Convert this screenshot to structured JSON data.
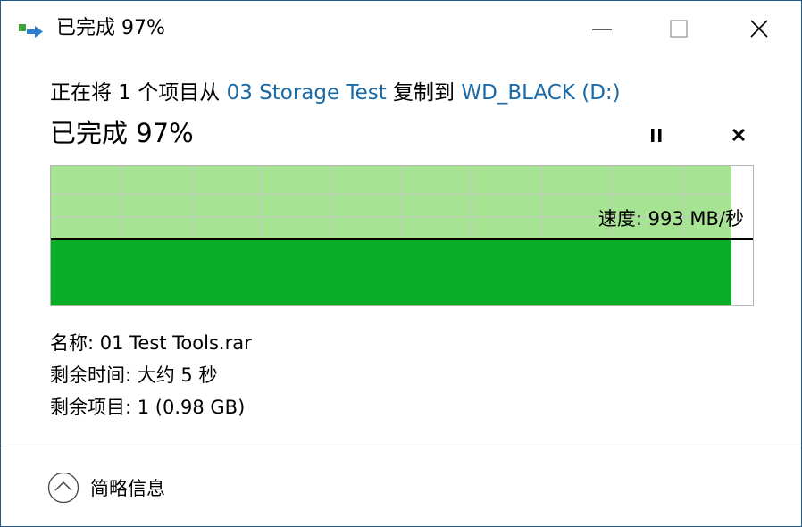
{
  "window": {
    "title": "已完成 97%",
    "icon": "copy-arrow-icon"
  },
  "operation": {
    "prefix": "正在将 1 个项目从 ",
    "source": "03 Storage Test",
    "middle": " 复制到 ",
    "destination": "WD_BLACK (D:)"
  },
  "status": {
    "title": "已完成 97%",
    "progress_percent": 97
  },
  "graph": {
    "speed_text": "速度: 993 MB/秒",
    "colors": {
      "completed_dark": "#06ad25",
      "completed_light": "#a6e392",
      "grid": "#c8c8c8",
      "speed_line": "#000000"
    }
  },
  "details": {
    "name": "名称: 01 Test Tools.rar",
    "time_left": "剩余时间: 大约 5 秒",
    "items_left": "剩余项目: 1 (0.98 GB)"
  },
  "footer": {
    "less_details_label": "简略信息"
  }
}
